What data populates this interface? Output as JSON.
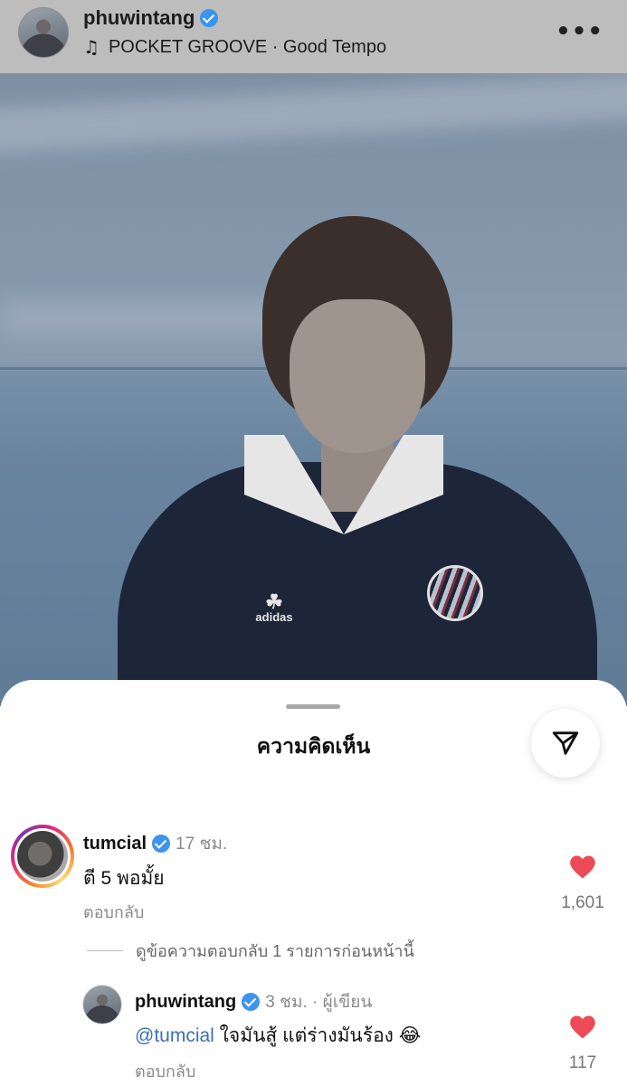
{
  "header": {
    "username": "phuwintang",
    "music_icon": "music-note-icon",
    "music_label": "POCKET GROOVE · Good Tempo",
    "more_icon": "more-horizontal-icon"
  },
  "sheet": {
    "title": "ความคิดเห็น",
    "send_icon": "paper-plane-icon"
  },
  "comments": [
    {
      "username": "tumcial",
      "time": "17 ชม.",
      "text": "ตี 5 พอมั้ย",
      "reply_label": "ตอบกลับ",
      "like_count": "1,601"
    }
  ],
  "view_replies_label": "ดูข้อความตอบกลับ 1 รายการก่อนหน้านี้",
  "reply": {
    "username": "phuwintang",
    "meta": "3 ชม. · ผู้เขียน",
    "mention": "@tumcial",
    "text": " ใจมันสู้ แต่ร่างมันร้อง 😂",
    "reply_label": "ตอบกลับ",
    "like_count": "117"
  },
  "photo": {
    "shirt_logo_text": "adidas"
  },
  "colors": {
    "verified": "#3b94ee",
    "heart": "#ed4956",
    "mention": "#3b6fb6"
  }
}
